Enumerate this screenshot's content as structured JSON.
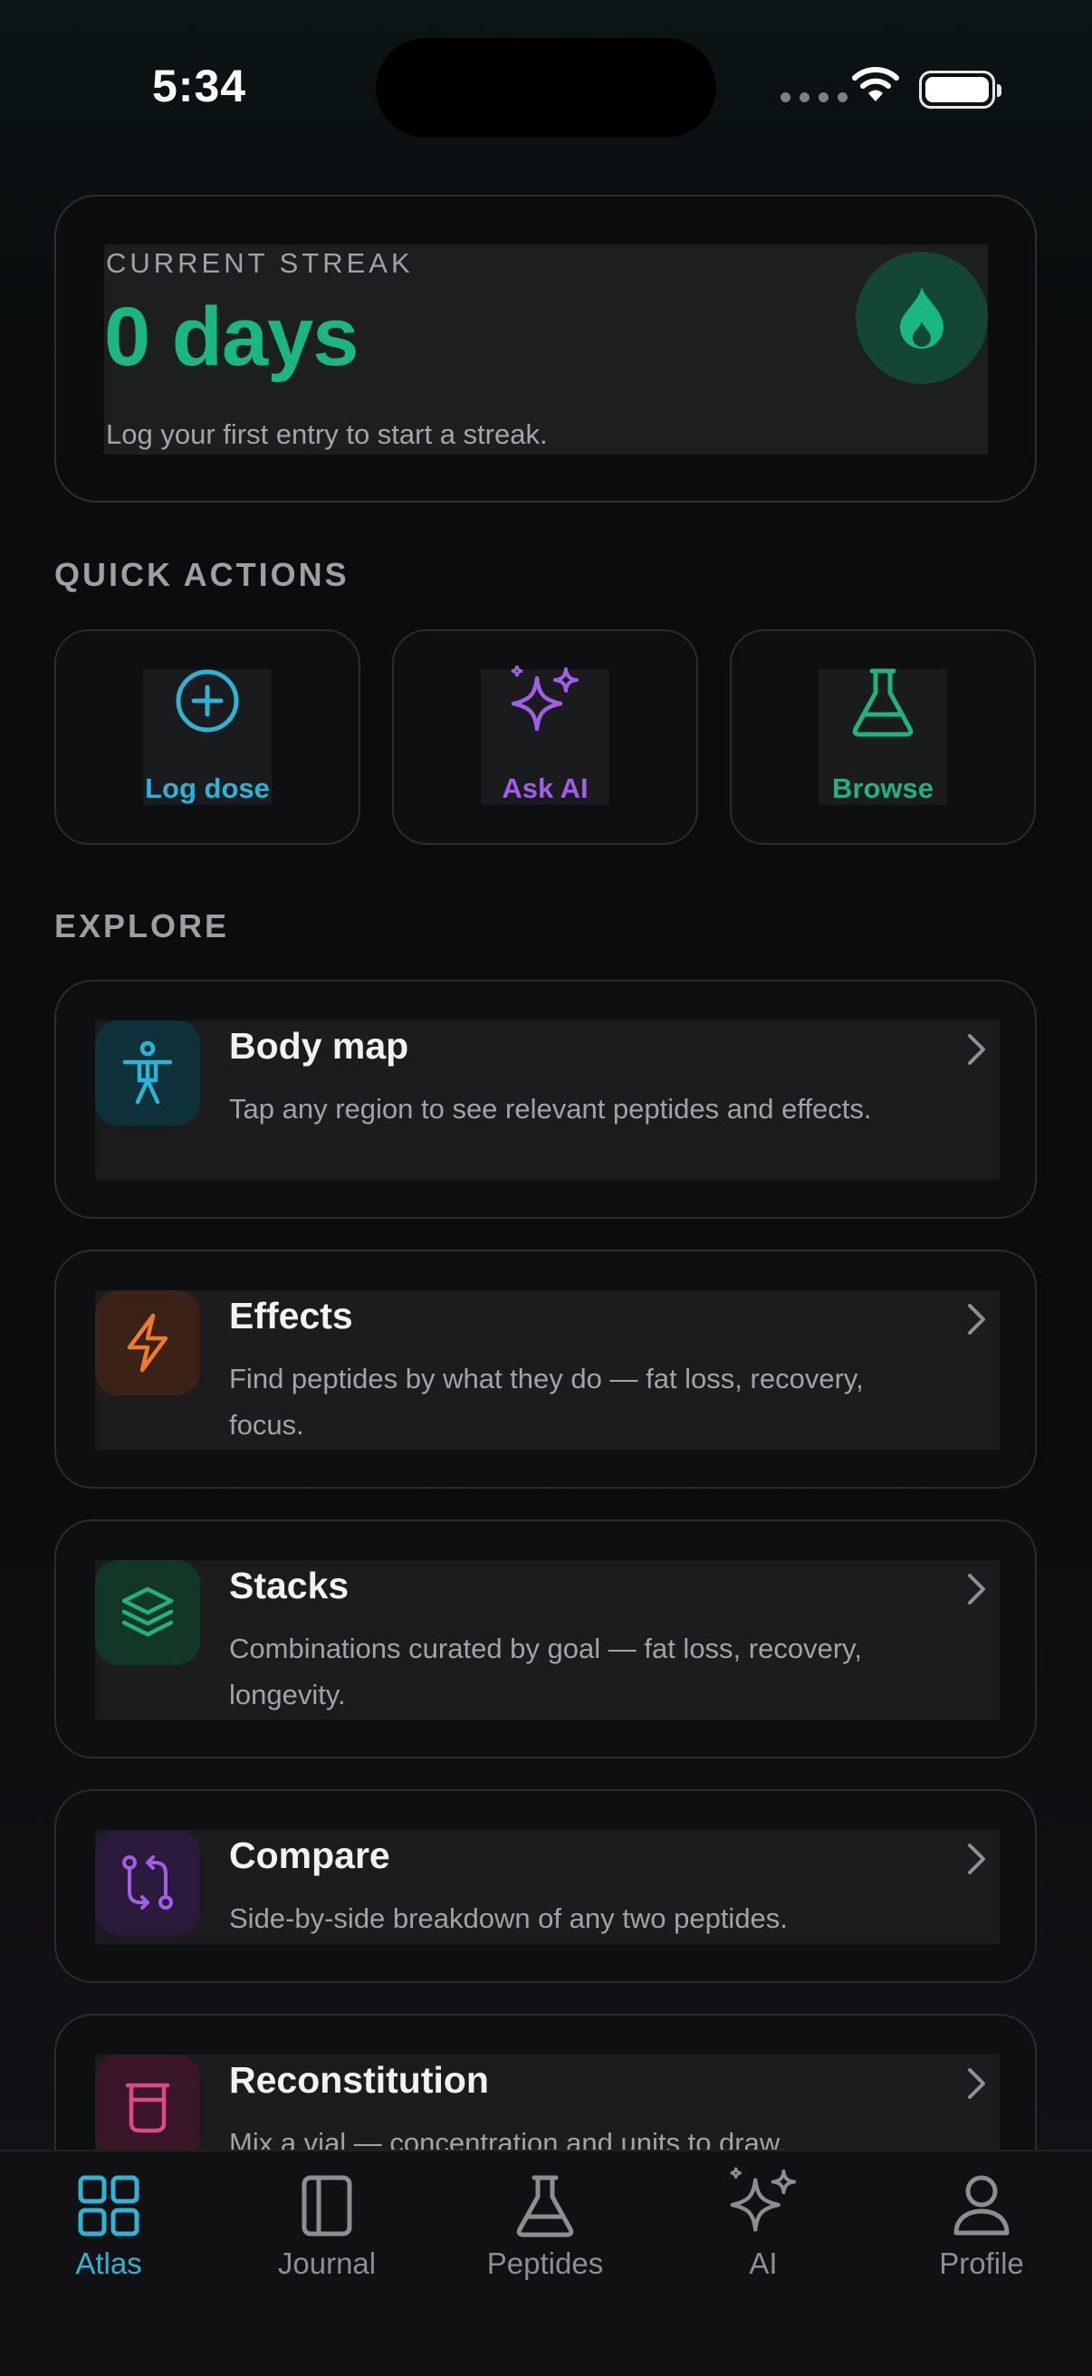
{
  "status_bar": {
    "time": "5:34"
  },
  "streak": {
    "label": "CURRENT STREAK",
    "value": "0 days",
    "subtitle": "Log your first entry to start a streak.",
    "accent": "#19b882"
  },
  "quick_actions": {
    "title": "QUICK ACTIONS",
    "items": [
      {
        "label": "Log dose",
        "icon": "plus-circle-icon",
        "color": "#2cb3d6"
      },
      {
        "label": "Ask AI",
        "icon": "sparkles-icon",
        "color": "#a25ee8"
      },
      {
        "label": "Browse",
        "icon": "flask-icon",
        "color": "#1fb37e"
      }
    ]
  },
  "explore": {
    "title": "EXPLORE",
    "items": [
      {
        "title": "Body map",
        "description": "Tap any region to see relevant peptides and effects.",
        "icon": "person-icon",
        "color": "#27b6d8"
      },
      {
        "title": "Effects",
        "description": "Find peptides by what they do — fat loss, recovery, focus.",
        "icon": "lightning-icon",
        "color": "#f07a2a"
      },
      {
        "title": "Stacks",
        "description": "Combinations curated by goal — fat loss, recovery, longevity.",
        "icon": "layers-icon",
        "color": "#1fb37e"
      },
      {
        "title": "Compare",
        "description": "Side-by-side breakdown of any two peptides.",
        "icon": "compare-arrows-icon",
        "color": "#a25ee8"
      },
      {
        "title": "Reconstitution",
        "description": "Mix a vial — concentration and units to draw.",
        "icon": "beaker-icon",
        "color": "#e0468c"
      }
    ]
  },
  "tab_bar": {
    "active": "Atlas",
    "active_color": "#2cb3d6",
    "items": [
      {
        "label": "Atlas",
        "icon": "grid-icon"
      },
      {
        "label": "Journal",
        "icon": "book-icon"
      },
      {
        "label": "Peptides",
        "icon": "flask-icon"
      },
      {
        "label": "AI",
        "icon": "sparkles-icon"
      },
      {
        "label": "Profile",
        "icon": "person-icon"
      }
    ]
  }
}
